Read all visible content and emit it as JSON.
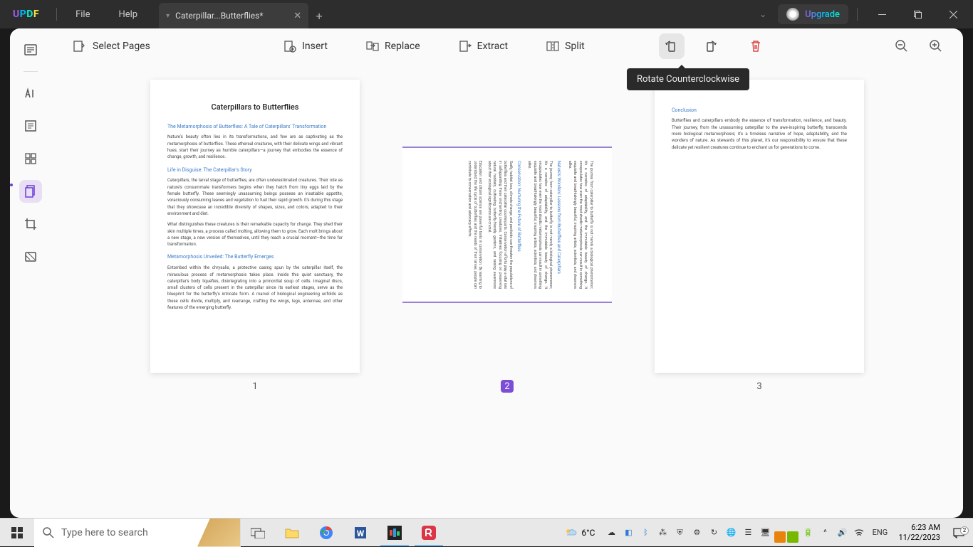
{
  "menu": {
    "file": "File",
    "help": "Help"
  },
  "tab": {
    "title": "Caterpillar...Butterflies*"
  },
  "upgrade": "Upgrade",
  "toolbar": {
    "select_pages": "Select Pages",
    "insert": "Insert",
    "replace": "Replace",
    "extract": "Extract",
    "split": "Split"
  },
  "tooltip": {
    "rotate_ccw": "Rotate Counterclockwise"
  },
  "pages": {
    "p1": {
      "num": "1",
      "title": "Caterpillars to Butterflies",
      "h1": "The Metamorphosis of Butterflies: A Tale of Caterpillars' Transformation",
      "p1": "Nature's beauty often lies in its transformations, and few are as captivating as the metamorphosis of butterflies. These ethereal creatures, with their delicate wings and vibrant hues, start their journey as humble caterpillars—a journey that embodies the essence of change, growth, and resilience.",
      "h2": "Life in Disguise: The Caterpillar's Story",
      "p2": "Caterpillars, the larval stage of butterflies, are often underestimated creatures. Their role as nature's consummate transformers begins when they hatch from tiny eggs laid by the female butterfly. These seemingly unassuming beings possess an insatiable appetite, voraciously consuming leaves and vegetation to fuel their rapid growth. It's during this stage that they showcase an incredible diversity of shapes, sizes, and colors, adapted to their environment and diet.",
      "p3": "What distinguishes these creatures is their remarkable capacity for change. They shed their skin multiple times, a process called molting, allowing them to grow. Each molt brings about a new stage, a new version of themselves, until they reach a crucial moment—the time for transformation.",
      "h3": "Metamorphosis Unveiled: The Butterfly Emerges",
      "p4": "Entombed within the chrysalis, a protective casing spun by the caterpillar itself, the miraculous process of metamorphosis takes place. Inside this quiet sanctuary, the caterpillar's body liquefies, disintegrating into a primordial soup of cells. Imaginal discs, small clusters of cells present in the caterpillar since its earliest stages, serve as the blueprint for the butterfly's intricate form. A marvel of biological engineering unfolds as these cells divide, multiply, and rearrange, crafting the wings, legs, antennae, and other features of the emerging butterfly."
    },
    "p2": {
      "num": "2",
      "h1": "Nature's Wonders: Lessons from Butterflies and Caterpillars",
      "p1": "The journey from caterpillar to butterfly is not merely a biological phenomenon; it's a narrative of adaptability, and the immutable beauty of change. It encapsulates how even the most drastic metamorphosis can result in something exquisite and breathtakingly beautiful, inspiring artists, scientists, and dreamers alike.",
      "h2": "Conservation: Nurturing the Future of Butterflies",
      "p2": "Sadly, habitat loss, climate change, and pesticide use threaten the populations of butterflies and their caterpillar counterparts. Conservation efforts play a vital role in safeguarding these enchanting creatures. Initiatives focusing on preserving natural habitats, cultivating butterfly-friendly gardens, and raising awareness about their ecological significance are crucial.",
      "p3": "Education and citizen science are powerful tools in conservation. By learning to understand the life cycle of butterflies and the needs of their larvae, people can contribute to conservation and advocacy efforts."
    },
    "p3": {
      "num": "3",
      "h1": "Conclusion",
      "p1": "Butterflies and caterpillars embody the essence of transformation, resilience, and beauty. Their journey, from the unassuming caterpillar to the awe-inspiring butterfly, transcends mere biological metamorphosis; it's a timeless narrative of hope, adaptability, and the wonders of nature. As stewards of this planet, it's our responsibility to ensure that these delicate yet resilient creatures continue to enchant us for generations to come."
    }
  },
  "taskbar": {
    "search_placeholder": "Type here to search",
    "weather": "6°C",
    "lang": "ENG",
    "time": "6:23 AM",
    "date": "11/22/2023",
    "notif_count": "2"
  }
}
